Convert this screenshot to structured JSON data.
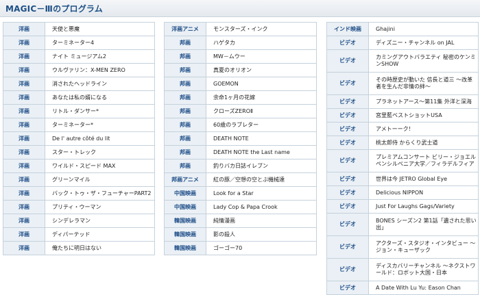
{
  "page": {
    "title": "MAGIC－Ⅲのプログラム"
  },
  "columns": [
    {
      "rows": [
        {
          "category": "洋画",
          "title": "天使と悪魔"
        },
        {
          "category": "洋画",
          "title": "ターミネーター4"
        },
        {
          "category": "洋画",
          "title": "ナイト ミュージアム2"
        },
        {
          "category": "洋画",
          "title": "ウルヴァリン：X-MEN ZERO"
        },
        {
          "category": "洋画",
          "title": "消されたヘッドライン"
        },
        {
          "category": "洋画",
          "title": "あなたは私の婿になる"
        },
        {
          "category": "洋画",
          "title": "リトル・ダンサー*"
        },
        {
          "category": "洋画",
          "title": "ターミネーター*"
        },
        {
          "category": "洋画",
          "title": "De l' autre côté du lit"
        },
        {
          "category": "洋画",
          "title": "スター・トレック"
        },
        {
          "category": "洋画",
          "title": "ワイルド・スピード MAX"
        },
        {
          "category": "洋画",
          "title": "グリーンマイル"
        },
        {
          "category": "洋画",
          "title": "バック・トゥ・ザ・フューチャーPART2"
        },
        {
          "category": "洋画",
          "title": "プリティ・ウーマン"
        },
        {
          "category": "洋画",
          "title": "シンデレラマン"
        },
        {
          "category": "洋画",
          "title": "ディパーテッド"
        },
        {
          "category": "洋画",
          "title": "俺たちに明日はない"
        }
      ]
    },
    {
      "rows": [
        {
          "category": "洋画アニメ",
          "title": "モンスターズ・インク"
        },
        {
          "category": "邦画",
          "title": "ハゲタカ"
        },
        {
          "category": "邦画",
          "title": "MW－ムウー"
        },
        {
          "category": "邦画",
          "title": "真夏のオリオン"
        },
        {
          "category": "邦画",
          "title": "GOEMON"
        },
        {
          "category": "邦画",
          "title": "余命1ヶ月の花嫁"
        },
        {
          "category": "邦画",
          "title": "クローズZEROⅡ"
        },
        {
          "category": "邦画",
          "title": "60歳のラブレター"
        },
        {
          "category": "邦画",
          "title": "DEATH NOTE"
        },
        {
          "category": "邦画",
          "title": "DEATH NOTE the Last name"
        },
        {
          "category": "邦画",
          "title": "釣りバカ日誌イレブン"
        },
        {
          "category": "邦画アニメ",
          "title": "紅の豚／空想の空とぶ機械達"
        },
        {
          "category": "中国映画",
          "title": "Look for a Star"
        },
        {
          "category": "中国映画",
          "title": "Lady Cop & Papa Crook"
        },
        {
          "category": "韓国映画",
          "title": "純情漫画"
        },
        {
          "category": "韓国映画",
          "title": "影の殺人"
        },
        {
          "category": "韓国映画",
          "title": "ゴーゴー70"
        }
      ]
    },
    {
      "rows": [
        {
          "category": "インド映画",
          "title": "Ghajini"
        },
        {
          "category": "ビデオ",
          "title": "ディズニー・チャンネル on JAL"
        },
        {
          "category": "ビデオ",
          "title": "カミングアウトバラエティ 秘密のケンミンSHOW"
        },
        {
          "category": "ビデオ",
          "title": "その時歴史が動いた 信長と道三 ～改革者を生んだ非情の絆～"
        },
        {
          "category": "ビデオ",
          "title": "プラネットアース～第11集 外洋と深海"
        },
        {
          "category": "ビデオ",
          "title": "宮里藍ベストショットUSA"
        },
        {
          "category": "ビデオ",
          "title": "アメトーーク！"
        },
        {
          "category": "ビデオ",
          "title": "桃太郎侍 からくり武士道"
        },
        {
          "category": "ビデオ",
          "title": "プレミアムコンサート ビリー・ジョエル ペンシルベニア大学／フィラデルフィア"
        },
        {
          "category": "ビデオ",
          "title": "世界は今 JETRO Global Eye"
        },
        {
          "category": "ビデオ",
          "title": "Delicious NIPPON"
        },
        {
          "category": "ビデオ",
          "title": "Just For Laughs Gags/Variety"
        },
        {
          "category": "ビデオ",
          "title": "BONES シーズン2 第1話「遺された思い出」"
        },
        {
          "category": "ビデオ",
          "title": "アクターズ・スタジオ・インタビュー ～ジョン・キューザック"
        },
        {
          "category": "ビデオ",
          "title": "ディスカバリーチャンネル ～ネクストワールド：ロボット大国・日本"
        },
        {
          "category": "ビデオ",
          "title": "A Date With Lu Yu: Eason Chan"
        }
      ]
    }
  ]
}
